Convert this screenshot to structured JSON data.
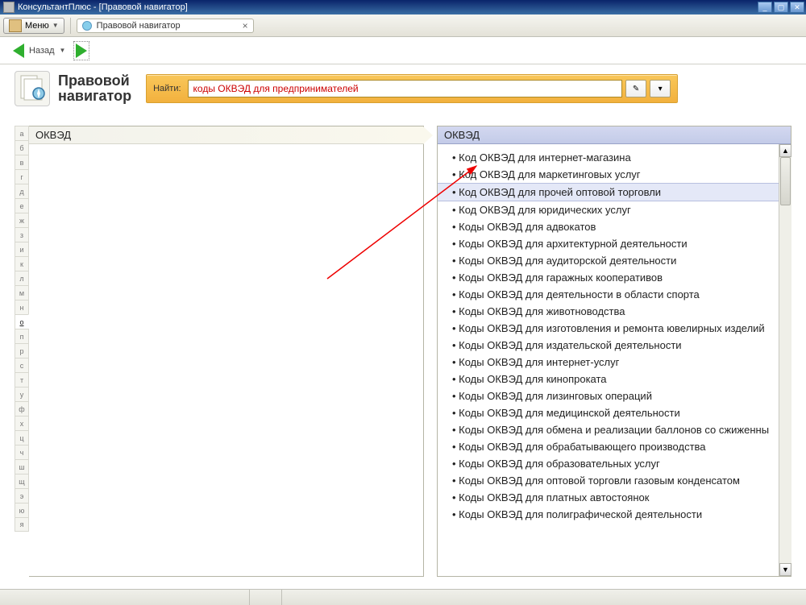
{
  "window": {
    "title": "КонсультантПлюс - [Правовой навигатор]"
  },
  "toolbar": {
    "menu_label": "Меню"
  },
  "tab": {
    "label": "Правовой навигатор"
  },
  "nav": {
    "back_label": "Назад"
  },
  "page": {
    "title_line1": "Правовой",
    "title_line2": "навигатор"
  },
  "search": {
    "label": "Найти:",
    "value": "коды ОКВЭД для предпринимателей"
  },
  "alpha": {
    "letters": [
      "а",
      "б",
      "в",
      "г",
      "д",
      "е",
      "ж",
      "з",
      "и",
      "к",
      "л",
      "м",
      "н",
      "о",
      "п",
      "р",
      "с",
      "т",
      "у",
      "ф",
      "х",
      "ц",
      "ч",
      "ш",
      "щ",
      "э",
      "ю",
      "я"
    ],
    "selected_index": 13
  },
  "left_panel": {
    "header": "ОКВЭД"
  },
  "right_panel": {
    "header": "ОКВЭД",
    "selected_index": 2,
    "items": [
      "Код ОКВЭД для интернет-магазина",
      "Код ОКВЭД для маркетинговых услуг",
      "Код ОКВЭД для прочей оптовой торговли",
      "Код ОКВЭД для юридических услуг",
      "Коды ОКВЭД для адвокатов",
      "Коды ОКВЭД для архитектурной деятельности",
      "Коды ОКВЭД для аудиторской деятельности",
      "Коды ОКВЭД для гаражных кооперативов",
      "Коды ОКВЭД для деятельности в области спорта",
      "Коды ОКВЭД для животноводства",
      "Коды ОКВЭД для изготовления и ремонта ювелирных изделий",
      "Коды ОКВЭД для издательской деятельности",
      "Коды ОКВЭД для интернет-услуг",
      "Коды ОКВЭД для кинопроката",
      "Коды ОКВЭД для лизинговых операций",
      "Коды ОКВЭД для медицинской деятельности",
      "Коды ОКВЭД для обмена и реализации баллонов со сжиженны",
      "Коды ОКВЭД для обрабатывающего производства",
      "Коды ОКВЭД для образовательных услуг",
      "Коды ОКВЭД для оптовой торговли газовым конденсатом",
      "Коды ОКВЭД для платных автостоянок",
      "Коды ОКВЭД для полиграфической деятельности"
    ]
  }
}
